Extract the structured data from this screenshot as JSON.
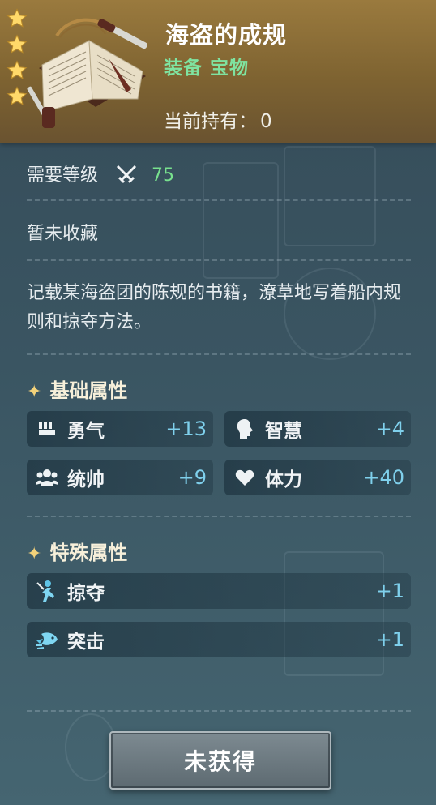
{
  "item": {
    "title": "海盗的成规",
    "type": "装备 宝物",
    "owned_label": "当前持有：",
    "owned_count": "0",
    "rarity_stars": 4
  },
  "requirement": {
    "label": "需要等级",
    "level": "75"
  },
  "collection_status": "暂未收藏",
  "description": "记载某海盗团的陈规的书籍，潦草地写着船内规则和掠夺方法。",
  "basic_attributes": {
    "heading": "基础属性",
    "stats": [
      {
        "icon": "fist-icon",
        "label": "勇气",
        "value": "+13"
      },
      {
        "icon": "head-icon",
        "label": "智慧",
        "value": "+4"
      },
      {
        "icon": "group-icon",
        "label": "统帅",
        "value": "+9"
      },
      {
        "icon": "heart-icon",
        "label": "体力",
        "value": "+40"
      }
    ]
  },
  "special_attributes": {
    "heading": "特殊属性",
    "stats": [
      {
        "icon": "plunder-icon",
        "label": "掠夺",
        "value": "+1"
      },
      {
        "icon": "raid-icon",
        "label": "突击",
        "value": "+1"
      }
    ]
  },
  "action_button": "未获得",
  "colors": {
    "header_gold": "#8a6d36",
    "type_green": "#7fe3a0",
    "level_green": "#78e18e",
    "stat_value_blue": "#7fd0ec",
    "star_gold": "#ffd96a"
  }
}
